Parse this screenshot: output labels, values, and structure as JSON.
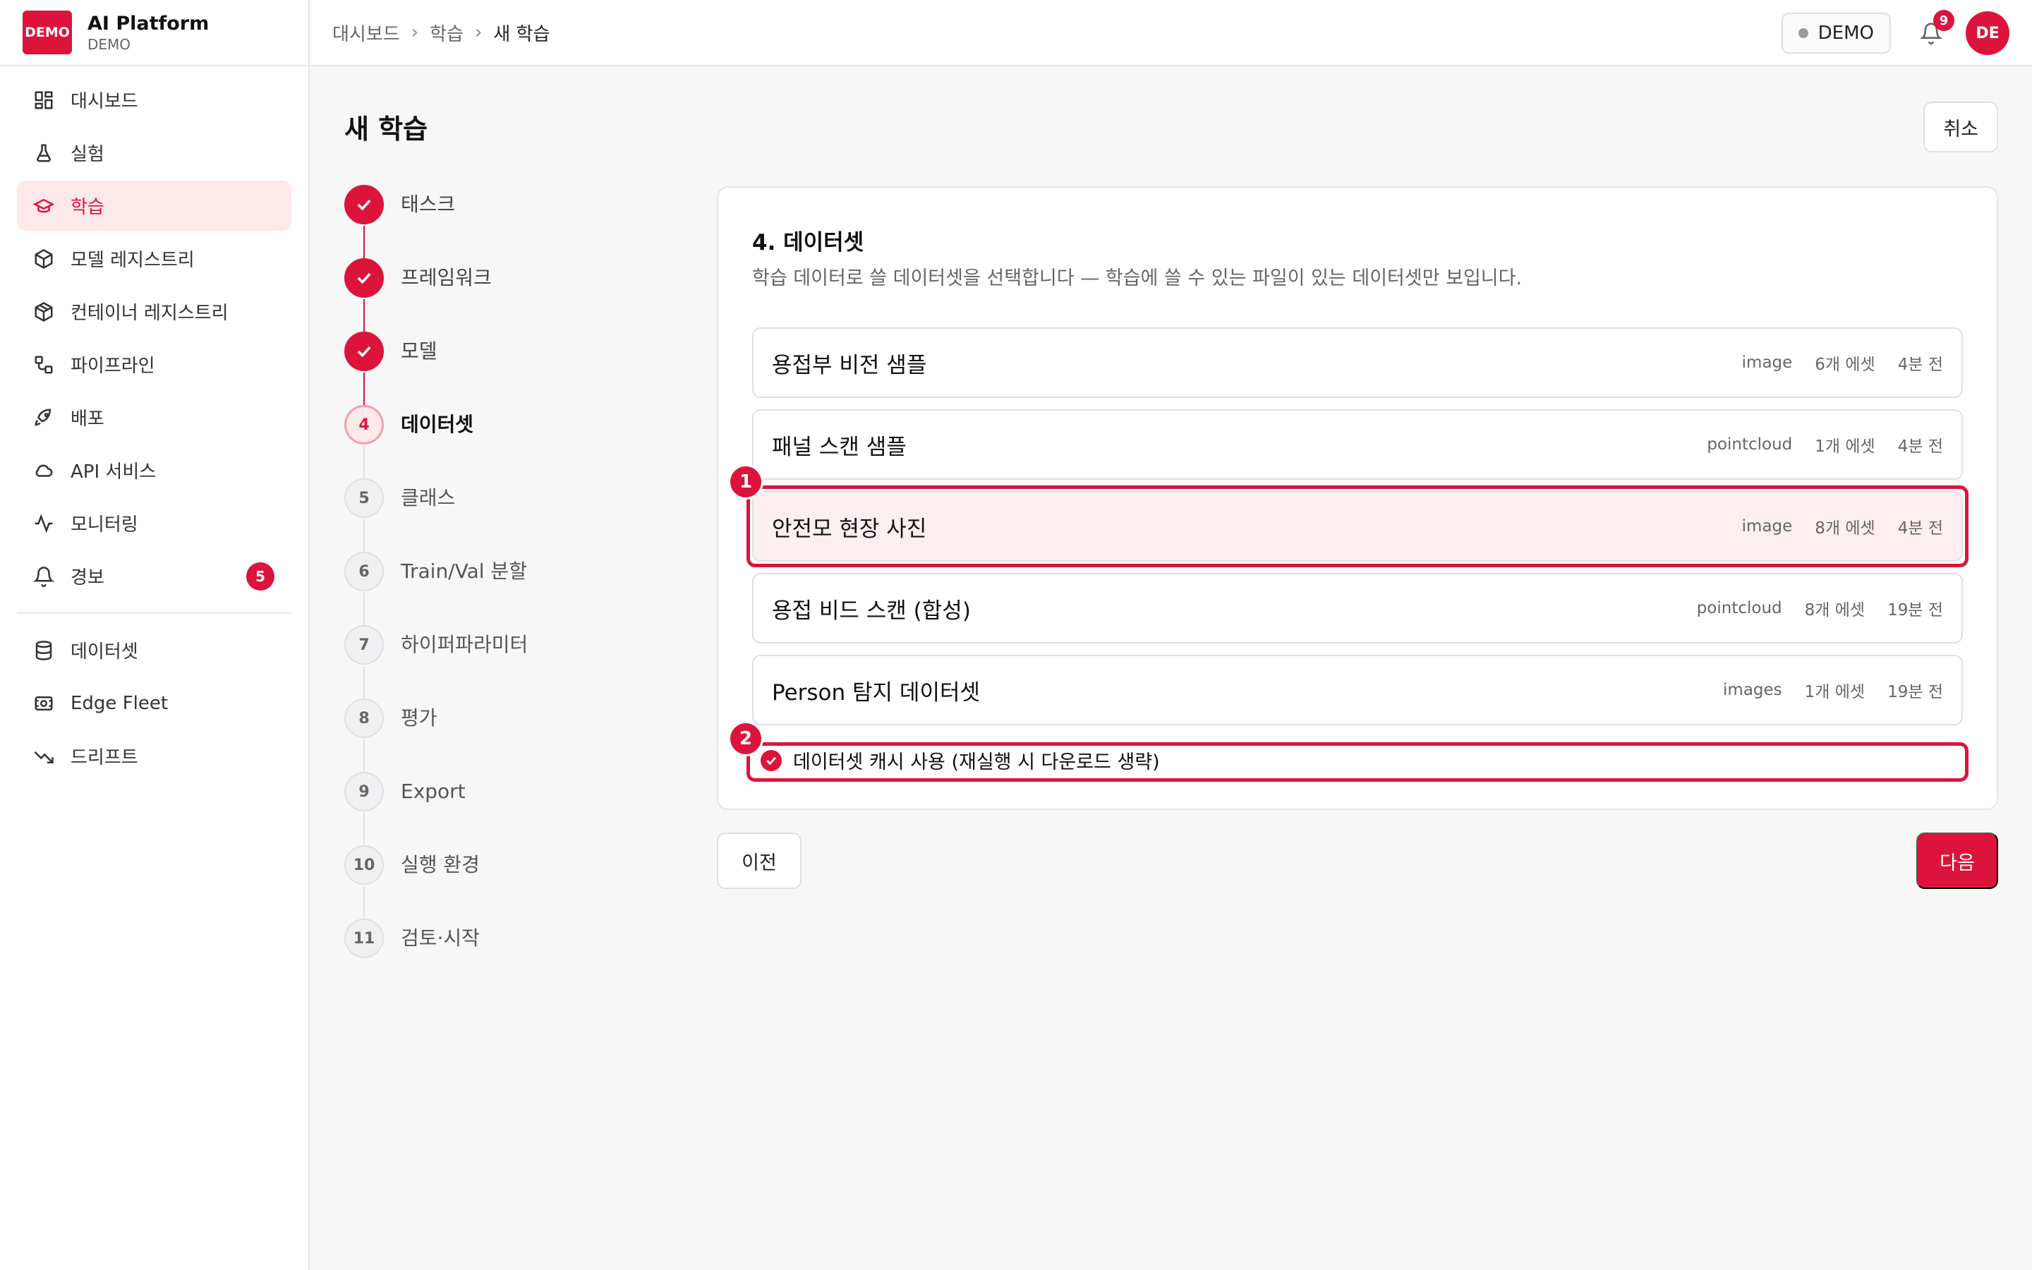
{
  "brand": {
    "logo_text": "DEMO",
    "title": "AI Platform",
    "subtitle": "DEMO"
  },
  "sidebar": {
    "items": [
      {
        "label": "대시보드",
        "icon": "dashboard-icon"
      },
      {
        "label": "실험",
        "icon": "flask-icon"
      },
      {
        "label": "학습",
        "icon": "graduation-cap-icon",
        "active": true
      },
      {
        "label": "모델 레지스트리",
        "icon": "cube-icon"
      },
      {
        "label": "컨테이너 레지스트리",
        "icon": "container-icon"
      },
      {
        "label": "파이프라인",
        "icon": "pipeline-icon"
      },
      {
        "label": "배포",
        "icon": "rocket-icon"
      },
      {
        "label": "API 서비스",
        "icon": "cloud-icon"
      },
      {
        "label": "모니터링",
        "icon": "activity-icon"
      },
      {
        "label": "경보",
        "icon": "bell-icon",
        "badge": "5"
      }
    ],
    "items2": [
      {
        "label": "데이터셋",
        "icon": "database-icon"
      },
      {
        "label": "Edge Fleet",
        "icon": "edge-device-icon"
      },
      {
        "label": "드리프트",
        "icon": "trend-down-icon"
      }
    ]
  },
  "topbar": {
    "breadcrumb": [
      "대시보드",
      "학습",
      "새 학습"
    ],
    "env_label": "DEMO",
    "notifications": "9",
    "avatar": "DE"
  },
  "page": {
    "title": "새 학습",
    "cancel_label": "취소"
  },
  "stepper": {
    "steps": [
      {
        "num": "1",
        "label": "태스크",
        "state": "done"
      },
      {
        "num": "2",
        "label": "프레임워크",
        "state": "done"
      },
      {
        "num": "3",
        "label": "모델",
        "state": "done"
      },
      {
        "num": "4",
        "label": "데이터셋",
        "state": "current"
      },
      {
        "num": "5",
        "label": "클래스",
        "state": "todo"
      },
      {
        "num": "6",
        "label": "Train/Val 분할",
        "state": "todo"
      },
      {
        "num": "7",
        "label": "하이퍼파라미터",
        "state": "todo"
      },
      {
        "num": "8",
        "label": "평가",
        "state": "todo"
      },
      {
        "num": "9",
        "label": "Export",
        "state": "todo"
      },
      {
        "num": "10",
        "label": "실행 환경",
        "state": "todo"
      },
      {
        "num": "11",
        "label": "검토·시작",
        "state": "todo"
      }
    ]
  },
  "dataset_step": {
    "title": "4. 데이터셋",
    "description": "학습 데이터로 쓸 데이터셋을 선택합니다 — 학습에 쓸 수 있는 파일이 있는 데이터셋만 보입니다.",
    "datasets": [
      {
        "name": "용접부 비전 샘플",
        "type": "image",
        "assets": "6개 에셋",
        "time": "4분 전"
      },
      {
        "name": "패널 스캔 샘플",
        "type": "pointcloud",
        "assets": "1개 에셋",
        "time": "4분 전"
      },
      {
        "name": "안전모 현장 사진",
        "type": "image",
        "assets": "8개 에셋",
        "time": "4분 전",
        "selected": true
      },
      {
        "name": "용접 비드 스캔 (합성)",
        "type": "pointcloud",
        "assets": "8개 에셋",
        "time": "19분 전"
      },
      {
        "name": "Person 탐지 데이터셋",
        "type": "images",
        "assets": "1개 에셋",
        "time": "19분 전"
      }
    ],
    "cache_label": "데이터셋 캐시 사용 (재실행 시 다운로드 생략)",
    "cache_checked": true,
    "highlight_1": "1",
    "highlight_2": "2"
  },
  "footer": {
    "prev_label": "이전",
    "next_label": "다음"
  },
  "colors": {
    "accent": "#dc143c",
    "accent_light": "#fde8ea"
  }
}
